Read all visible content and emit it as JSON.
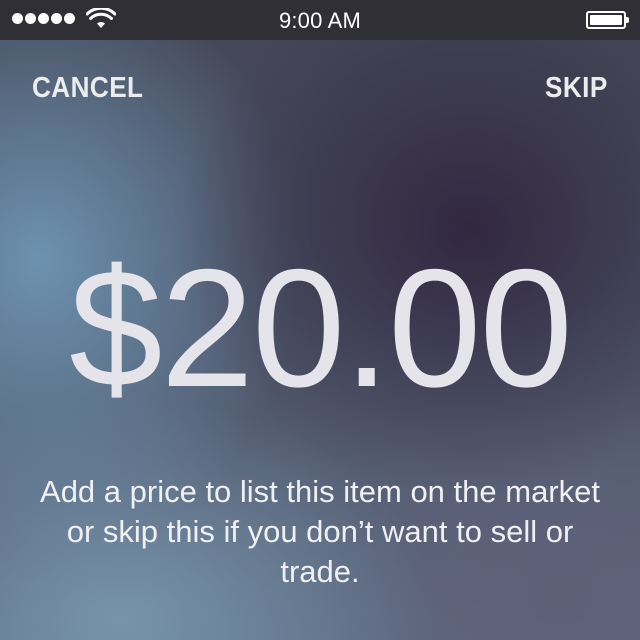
{
  "status_bar": {
    "time": "9:00 AM",
    "signal_icon": "signal-dots-icon",
    "wifi_icon": "wifi-icon",
    "battery_icon": "battery-icon",
    "battery_level": 1.0
  },
  "nav": {
    "cancel_label": "CANCEL",
    "skip_label": "SKIP"
  },
  "price": {
    "value": "$20.00"
  },
  "hint": {
    "text": "Add a price to list this item on the market or skip this if you don’t want to sell or trade."
  },
  "colors": {
    "status_bar_bg": "#2f2f35",
    "text": "#f2f2f4"
  }
}
